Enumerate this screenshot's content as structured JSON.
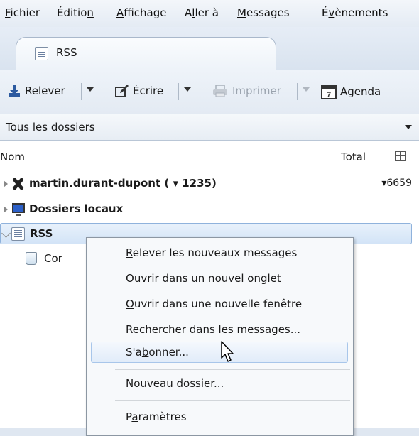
{
  "menubar": {
    "items": [
      {
        "pre": "",
        "u": "F",
        "post": "ichier"
      },
      {
        "pre": "Éditio",
        "u": "n",
        "post": ""
      },
      {
        "pre": "",
        "u": "A",
        "post": "ffichage"
      },
      {
        "pre": "A",
        "u": "l",
        "post": "ler à"
      },
      {
        "pre": "",
        "u": "M",
        "post": "essages"
      },
      {
        "pre": "É",
        "u": "v",
        "post": "ènements"
      }
    ]
  },
  "tabs": [
    {
      "label": "RSS",
      "icon": "feed-icon"
    }
  ],
  "toolbar": {
    "relever": "Relever",
    "ecrire": "Écrire",
    "imprimer": "Imprimer",
    "agenda": "Agenda"
  },
  "folder_selector": {
    "value": "Tous les dossiers"
  },
  "folder_pane": {
    "col_name": "Nom",
    "col_total": "Total",
    "rows": [
      {
        "label": "martin.durant-dupont ( ▾ 1235)",
        "total": "▾6659",
        "icon": "x-account-icon"
      },
      {
        "label": "Dossiers locaux",
        "total": "",
        "icon": "computer-icon"
      },
      {
        "label": "RSS",
        "total": "",
        "icon": "feed-icon"
      },
      {
        "label": "Cor",
        "total": "",
        "icon": "trash-icon"
      }
    ]
  },
  "context_menu": {
    "items": [
      {
        "pre": "",
        "u": "R",
        "post": "elever les nouveaux messages"
      },
      {
        "pre": "O",
        "u": "u",
        "post": "vrir dans un nouvel onglet"
      },
      {
        "pre": "",
        "u": "O",
        "post": "uvrir dans une nouvelle fenêtre"
      },
      {
        "pre": "Re",
        "u": "c",
        "post": "hercher dans les messages..."
      },
      {
        "pre": "S'a",
        "u": "b",
        "post": "onner..."
      },
      {
        "pre": "Nou",
        "u": "v",
        "post": "eau dossier..."
      },
      {
        "pre": "P",
        "u": "a",
        "post": "ramètres"
      }
    ],
    "highlighted": "S'abonner..."
  }
}
